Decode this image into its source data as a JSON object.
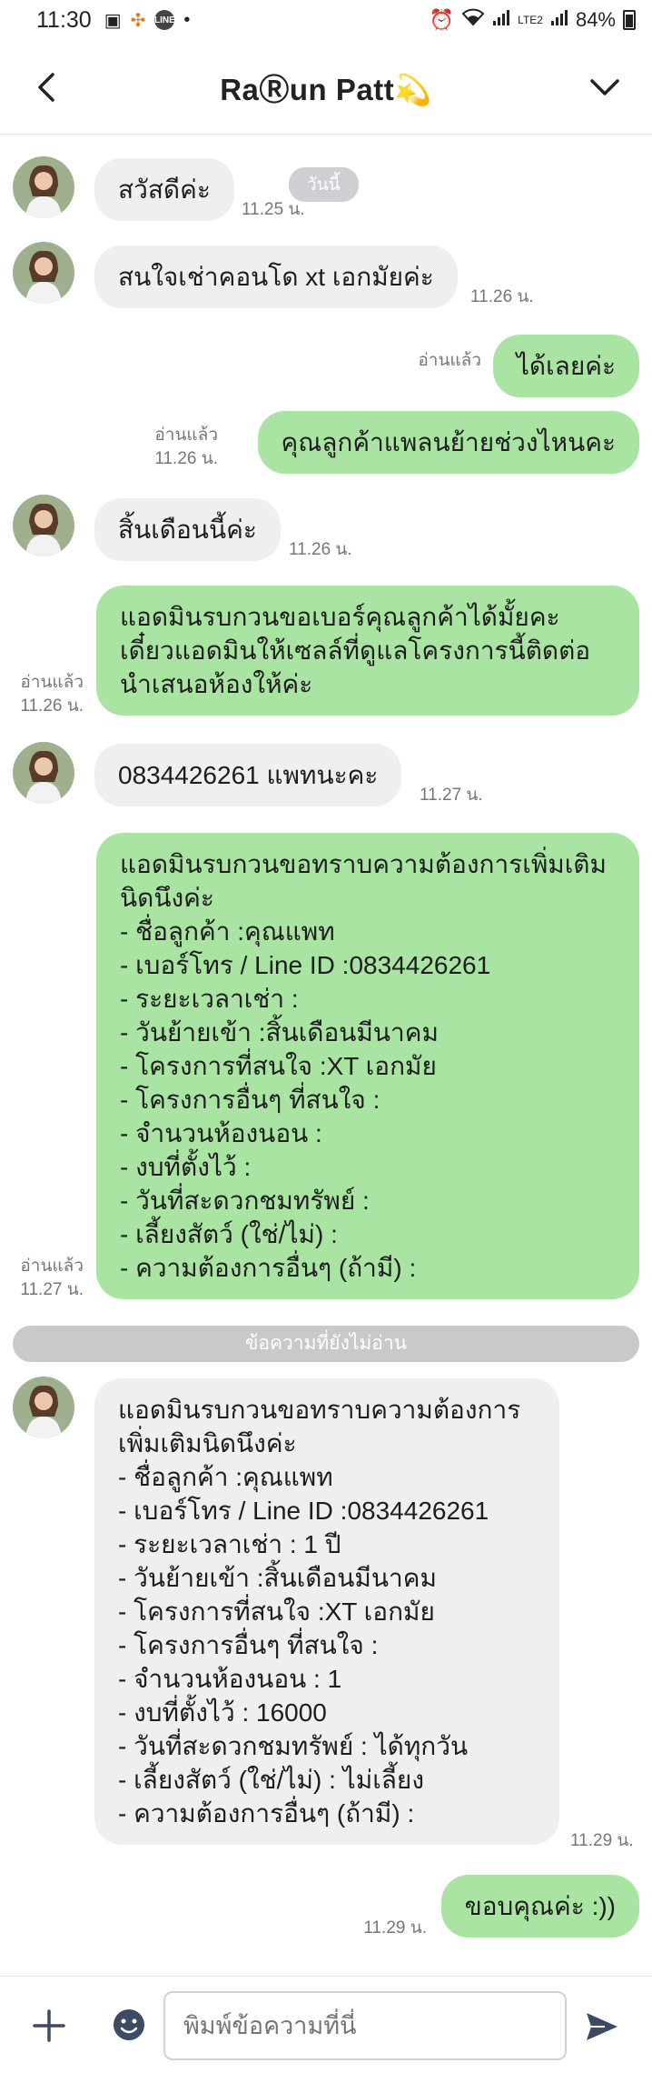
{
  "status_bar": {
    "time": "11:30",
    "battery": "84%",
    "network": "LTE2",
    "line_badge": "LINE"
  },
  "header": {
    "title": "RaⓇun Patt💫"
  },
  "chat": {
    "day_badge": "วันนี้",
    "unread_divider": "ข้อความที่ยังไม่อ่าน",
    "messages": [
      {
        "direction": "in",
        "text": "สวัสดีค่ะ",
        "time": "11.25 น."
      },
      {
        "direction": "in",
        "text": "สนใจเช่าคอนโด xt เอกมัยค่ะ",
        "time": "11.26 น."
      },
      {
        "direction": "out",
        "text": "ได้เลยค่ะ",
        "read": "อ่านแล้ว",
        "time": ""
      },
      {
        "direction": "out",
        "text": "คุณลูกค้าแพลนย้ายช่วงไหนคะ",
        "read": "อ่านแล้ว",
        "time": "11.26 น."
      },
      {
        "direction": "in",
        "text": "สิ้นเดือนนี้ค่ะ",
        "time": "11.26 น."
      },
      {
        "direction": "out",
        "text": "แอดมินรบกวนขอเบอร์คุณลูกค้าได้มั้ยคะ\nเดี๋ยวแอดมินให้เซลล์ที่ดูแลโครงการนี้ติดต่อ\nนำเสนอห้องให้ค่ะ",
        "read": "อ่านแล้ว",
        "time": "11.26 น."
      },
      {
        "direction": "in",
        "text": "0834426261 แพทนะคะ",
        "time": "11.27 น."
      },
      {
        "direction": "out",
        "text": "แอดมินรบกวนขอทราบความต้องการเพิ่มเติม\nนิดนึงค่ะ\n- ชื่อลูกค้า :คุณแพท\n- เบอร์โทร / Line ID :0834426261\n- ระยะเวลาเช่า :\n- วันย้ายเข้า :สิ้นเดือนมีนาคม\n- โครงการที่สนใจ :XT เอกมัย\n- โครงการอื่นๆ ที่สนใจ :\n- จำนวนห้องนอน :\n- งบที่ตั้งไว้ :\n- วันที่สะดวกชมทรัพย์ :\n- เลี้ยงสัตว์ (ใช่/ไม่) :\n- ความต้องการอื่นๆ (ถ้ามี) :",
        "read": "อ่านแล้ว",
        "time": "11.27 น."
      },
      {
        "direction": "in",
        "text": "แอดมินรบกวนขอทราบความต้องการ\nเพิ่มเติมนิดนึงค่ะ\n- ชื่อลูกค้า :คุณแพท\n- เบอร์โทร / Line ID :0834426261\n- ระยะเวลาเช่า : 1 ปี\n- วันย้ายเข้า :สิ้นเดือนมีนาคม\n- โครงการที่สนใจ :XT เอกมัย\n- โครงการอื่นๆ ที่สนใจ :\n- จำนวนห้องนอน : 1\n- งบที่ตั้งไว้ : 16000\n- วันที่สะดวกชมทรัพย์ : ได้ทุกวัน\n- เลี้ยงสัตว์ (ใช่/ไม่) : ไม่เลี้ยง\n- ความต้องการอื่นๆ (ถ้ามี) :",
        "time": "11.29 น."
      },
      {
        "direction": "out",
        "text": "ขอบคุณค่ะ :))",
        "read": "",
        "time": "11.29 น."
      }
    ]
  },
  "footer": {
    "input_placeholder": "พิมพ์ข้อความที่นี่"
  },
  "colors": {
    "outgoing_bubble": "#a9e4a2",
    "incoming_bubble": "#efeff0",
    "accent_icon": "#3c4a66"
  }
}
